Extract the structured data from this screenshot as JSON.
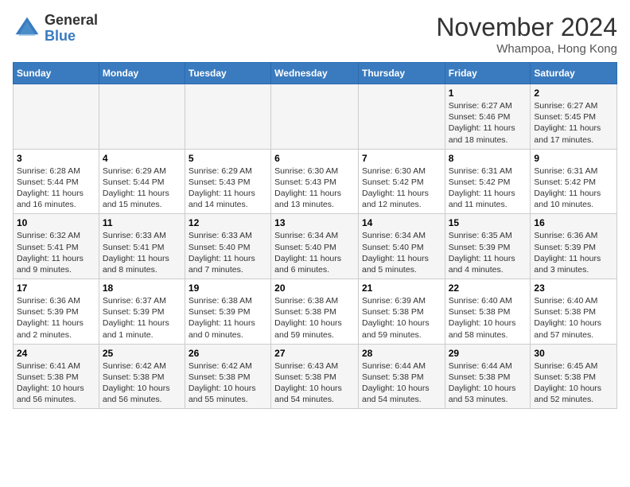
{
  "header": {
    "logo_line1": "General",
    "logo_line2": "Blue",
    "month_title": "November 2024",
    "location": "Whampoa, Hong Kong"
  },
  "weekdays": [
    "Sunday",
    "Monday",
    "Tuesday",
    "Wednesday",
    "Thursday",
    "Friday",
    "Saturday"
  ],
  "weeks": [
    [
      {
        "day": "",
        "info": ""
      },
      {
        "day": "",
        "info": ""
      },
      {
        "day": "",
        "info": ""
      },
      {
        "day": "",
        "info": ""
      },
      {
        "day": "",
        "info": ""
      },
      {
        "day": "1",
        "info": "Sunrise: 6:27 AM\nSunset: 5:46 PM\nDaylight: 11 hours and 18 minutes."
      },
      {
        "day": "2",
        "info": "Sunrise: 6:27 AM\nSunset: 5:45 PM\nDaylight: 11 hours and 17 minutes."
      }
    ],
    [
      {
        "day": "3",
        "info": "Sunrise: 6:28 AM\nSunset: 5:44 PM\nDaylight: 11 hours and 16 minutes."
      },
      {
        "day": "4",
        "info": "Sunrise: 6:29 AM\nSunset: 5:44 PM\nDaylight: 11 hours and 15 minutes."
      },
      {
        "day": "5",
        "info": "Sunrise: 6:29 AM\nSunset: 5:43 PM\nDaylight: 11 hours and 14 minutes."
      },
      {
        "day": "6",
        "info": "Sunrise: 6:30 AM\nSunset: 5:43 PM\nDaylight: 11 hours and 13 minutes."
      },
      {
        "day": "7",
        "info": "Sunrise: 6:30 AM\nSunset: 5:42 PM\nDaylight: 11 hours and 12 minutes."
      },
      {
        "day": "8",
        "info": "Sunrise: 6:31 AM\nSunset: 5:42 PM\nDaylight: 11 hours and 11 minutes."
      },
      {
        "day": "9",
        "info": "Sunrise: 6:31 AM\nSunset: 5:42 PM\nDaylight: 11 hours and 10 minutes."
      }
    ],
    [
      {
        "day": "10",
        "info": "Sunrise: 6:32 AM\nSunset: 5:41 PM\nDaylight: 11 hours and 9 minutes."
      },
      {
        "day": "11",
        "info": "Sunrise: 6:33 AM\nSunset: 5:41 PM\nDaylight: 11 hours and 8 minutes."
      },
      {
        "day": "12",
        "info": "Sunrise: 6:33 AM\nSunset: 5:40 PM\nDaylight: 11 hours and 7 minutes."
      },
      {
        "day": "13",
        "info": "Sunrise: 6:34 AM\nSunset: 5:40 PM\nDaylight: 11 hours and 6 minutes."
      },
      {
        "day": "14",
        "info": "Sunrise: 6:34 AM\nSunset: 5:40 PM\nDaylight: 11 hours and 5 minutes."
      },
      {
        "day": "15",
        "info": "Sunrise: 6:35 AM\nSunset: 5:39 PM\nDaylight: 11 hours and 4 minutes."
      },
      {
        "day": "16",
        "info": "Sunrise: 6:36 AM\nSunset: 5:39 PM\nDaylight: 11 hours and 3 minutes."
      }
    ],
    [
      {
        "day": "17",
        "info": "Sunrise: 6:36 AM\nSunset: 5:39 PM\nDaylight: 11 hours and 2 minutes."
      },
      {
        "day": "18",
        "info": "Sunrise: 6:37 AM\nSunset: 5:39 PM\nDaylight: 11 hours and 1 minute."
      },
      {
        "day": "19",
        "info": "Sunrise: 6:38 AM\nSunset: 5:39 PM\nDaylight: 11 hours and 0 minutes."
      },
      {
        "day": "20",
        "info": "Sunrise: 6:38 AM\nSunset: 5:38 PM\nDaylight: 10 hours and 59 minutes."
      },
      {
        "day": "21",
        "info": "Sunrise: 6:39 AM\nSunset: 5:38 PM\nDaylight: 10 hours and 59 minutes."
      },
      {
        "day": "22",
        "info": "Sunrise: 6:40 AM\nSunset: 5:38 PM\nDaylight: 10 hours and 58 minutes."
      },
      {
        "day": "23",
        "info": "Sunrise: 6:40 AM\nSunset: 5:38 PM\nDaylight: 10 hours and 57 minutes."
      }
    ],
    [
      {
        "day": "24",
        "info": "Sunrise: 6:41 AM\nSunset: 5:38 PM\nDaylight: 10 hours and 56 minutes."
      },
      {
        "day": "25",
        "info": "Sunrise: 6:42 AM\nSunset: 5:38 PM\nDaylight: 10 hours and 56 minutes."
      },
      {
        "day": "26",
        "info": "Sunrise: 6:42 AM\nSunset: 5:38 PM\nDaylight: 10 hours and 55 minutes."
      },
      {
        "day": "27",
        "info": "Sunrise: 6:43 AM\nSunset: 5:38 PM\nDaylight: 10 hours and 54 minutes."
      },
      {
        "day": "28",
        "info": "Sunrise: 6:44 AM\nSunset: 5:38 PM\nDaylight: 10 hours and 54 minutes."
      },
      {
        "day": "29",
        "info": "Sunrise: 6:44 AM\nSunset: 5:38 PM\nDaylight: 10 hours and 53 minutes."
      },
      {
        "day": "30",
        "info": "Sunrise: 6:45 AM\nSunset: 5:38 PM\nDaylight: 10 hours and 52 minutes."
      }
    ]
  ]
}
